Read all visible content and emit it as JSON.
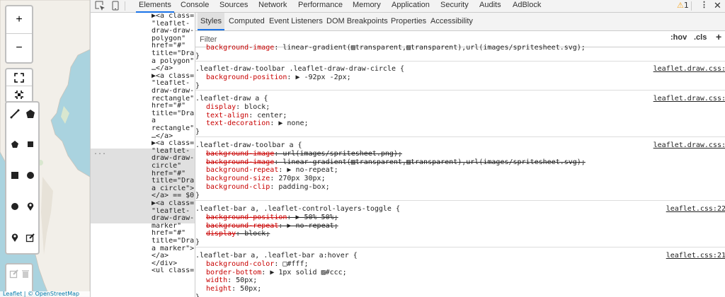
{
  "map": {
    "zoom_in": "+",
    "zoom_out": "−",
    "attribution": "Leaflet | © OpenStreetMap"
  },
  "devtools": {
    "panel_tabs": [
      "Elements",
      "Console",
      "Sources",
      "Network",
      "Performance",
      "Memory",
      "Application",
      "Security",
      "Audits",
      "AdBlock"
    ],
    "selected_panel": "Elements",
    "warning_count": "1",
    "subtabs": [
      "Styles",
      "Computed",
      "Event Listeners",
      "DOM Breakpoints",
      "Properties",
      "Accessibility"
    ],
    "selected_subtab": "Styles",
    "filter_placeholder": "Filter",
    "hov_label": ":hov",
    "cls_label": ".cls",
    "add_label": "+"
  },
  "tree": {
    "lines": [
      "▶<a class=",
      "\"leaflet-",
      "draw-draw-",
      "polygon\"",
      "href=\"#\"",
      "title=\"Draw",
      "a polygon\">",
      "…</a>",
      "▶<a class=",
      "\"leaflet-",
      "draw-draw-",
      "rectangle\"",
      "href=\"#\"",
      "title=\"Draw",
      "a",
      "rectangle\">",
      "…</a>",
      "▶<a class=",
      "\"leaflet-",
      "draw-draw-",
      "circle\"",
      "href=\"#\"",
      "title=\"Draw",
      "a circle\">",
      "</a> == $0",
      "▶<a class=",
      "\"leaflet-",
      "draw-draw-",
      "marker\"",
      "href=\"#\"",
      "title=\"Draw",
      "a marker\">",
      "</a>",
      "</div>",
      "<ul class="
    ]
  },
  "rules": [
    {
      "selector": "",
      "source": "",
      "props": [
        {
          "name": "background-image",
          "value": "linear-gradient(▨transparent,▨transparent),url(images/spritesheet.svg);",
          "struck": false
        }
      ]
    },
    {
      "selector": ".leaflet-draw-toolbar .leaflet-draw-draw-circle {",
      "source": "leaflet.draw.css:",
      "props": [
        {
          "name": "background-position",
          "value": "▶ -92px -2px;",
          "struck": false
        }
      ]
    },
    {
      "selector": ".leaflet-draw a {",
      "source": "leaflet.draw.css:",
      "props": [
        {
          "name": "display",
          "value": "block;",
          "struck": false
        },
        {
          "name": "text-align",
          "value": "center;",
          "struck": false
        },
        {
          "name": "text-decoration",
          "value": "▶ none;",
          "struck": false
        }
      ]
    },
    {
      "selector": ".leaflet-draw-toolbar a {",
      "source": "leaflet.draw.css:",
      "props": [
        {
          "name": "background-image",
          "value": "url(images/spritesheet.png);",
          "struck": true
        },
        {
          "name": "background-image",
          "value": "linear-gradient(▨transparent,▨transparent),url(images/spritesheet.svg);",
          "struck": true
        },
        {
          "name": "background-repeat",
          "value": "▶ no-repeat;",
          "struck": false
        },
        {
          "name": "background-size",
          "value": "270px 30px;",
          "struck": false
        },
        {
          "name": "background-clip",
          "value": "padding-box;",
          "struck": false
        }
      ]
    },
    {
      "selector": ".leaflet-bar a, .leaflet-control-layers-toggle {",
      "source": "leaflet.css:22",
      "props": [
        {
          "name": "background-position",
          "value": "▶ 50% 50%;",
          "struck": true
        },
        {
          "name": "background-repeat",
          "value": "▶ no-repeat;",
          "struck": true
        },
        {
          "name": "display",
          "value": "block;",
          "struck": true
        }
      ]
    },
    {
      "selector": ".leaflet-bar a, .leaflet-bar a:hover {",
      "source": "leaflet.css:21",
      "props": [
        {
          "name": "background-color",
          "value": "□#fff;",
          "struck": false
        },
        {
          "name": "border-bottom",
          "value": "▶ 1px solid ▨#ccc;",
          "struck": false
        },
        {
          "name": "width",
          "value": "50px;",
          "struck": false
        },
        {
          "name": "height",
          "value": "50px;",
          "struck": false
        }
      ]
    }
  ]
}
